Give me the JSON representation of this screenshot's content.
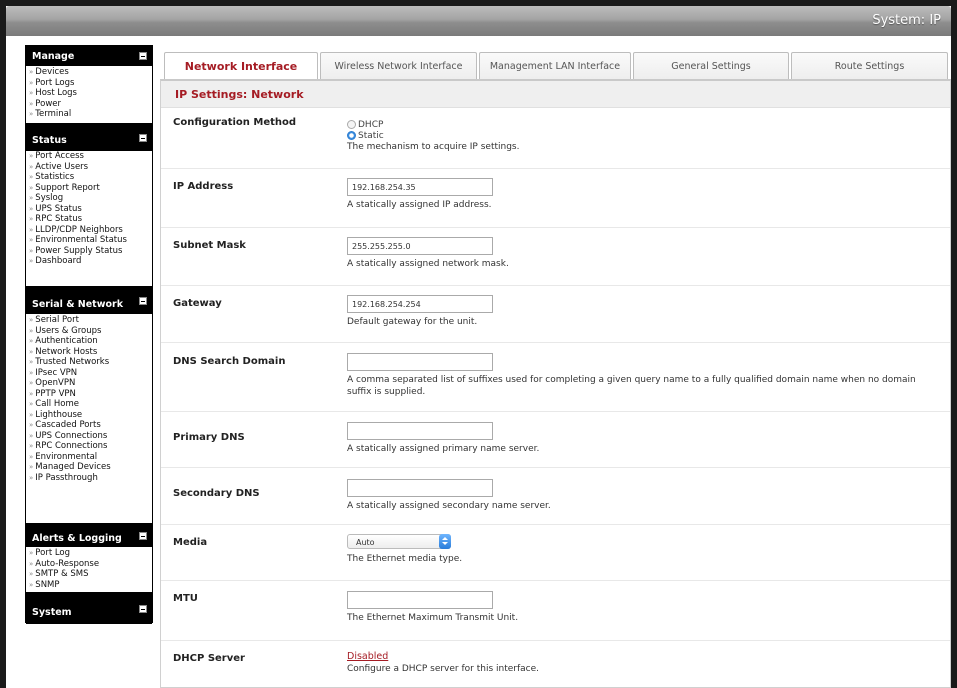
{
  "header": {
    "title": "System: IP"
  },
  "sidebar": {
    "panels": [
      {
        "title": "Manage",
        "items": [
          "Devices",
          "Port Logs",
          "Host Logs",
          "Power",
          "Terminal"
        ]
      },
      {
        "title": "Status",
        "items": [
          "Port Access",
          "Active Users",
          "Statistics",
          "Support Report",
          "Syslog",
          "UPS Status",
          "RPC Status",
          "LLDP/CDP Neighbors",
          "Environmental Status",
          "Power Supply Status",
          "Dashboard"
        ]
      },
      {
        "title": "Serial & Network",
        "items": [
          "Serial Port",
          "Users & Groups",
          "Authentication",
          "Network Hosts",
          "Trusted Networks",
          "IPsec VPN",
          "OpenVPN",
          "PPTP VPN",
          "Call Home",
          "Lighthouse",
          "Cascaded Ports",
          "UPS Connections",
          "RPC Connections",
          "Environmental",
          "Managed Devices",
          "IP Passthrough"
        ]
      },
      {
        "title": "Alerts & Logging",
        "items": [
          "Port Log",
          "Auto-Response",
          "SMTP & SMS",
          "SNMP"
        ]
      },
      {
        "title": "System",
        "items": []
      }
    ]
  },
  "tabs": [
    "Network Interface",
    "Wireless Network Interface",
    "Management LAN Interface",
    "General Settings",
    "Route Settings"
  ],
  "section_title": "IP Settings: Network",
  "form": {
    "config_method": {
      "label": "Configuration Method",
      "options": [
        "DHCP",
        "Static"
      ],
      "selected": "Static",
      "help": "The mechanism to acquire IP settings."
    },
    "ip_address": {
      "label": "IP Address",
      "value": "192.168.254.35",
      "help": "A statically assigned IP address."
    },
    "subnet_mask": {
      "label": "Subnet Mask",
      "value": "255.255.255.0",
      "help": "A statically assigned network mask."
    },
    "gateway": {
      "label": "Gateway",
      "value": "192.168.254.254",
      "help": "Default gateway for the unit."
    },
    "dns_search": {
      "label": "DNS Search Domain",
      "value": "",
      "help": "A comma separated list of suffixes used for completing a given query name to a fully qualified domain name when no domain suffix is supplied."
    },
    "primary_dns": {
      "label": "Primary DNS",
      "value": "",
      "help": "A statically assigned primary name server."
    },
    "secondary_dns": {
      "label": "Secondary DNS",
      "value": "",
      "help": "A statically assigned secondary name server."
    },
    "media": {
      "label": "Media",
      "value": "Auto",
      "help": "The Ethernet media type."
    },
    "mtu": {
      "label": "MTU",
      "value": "",
      "help": "The Ethernet Maximum Transmit Unit."
    },
    "dhcp_server": {
      "label": "DHCP Server",
      "link": "Disabled",
      "help": "Configure a DHCP server for this interface."
    }
  },
  "colors": {
    "accent": "#a51c24",
    "radio_selected": "#3a8de0"
  }
}
